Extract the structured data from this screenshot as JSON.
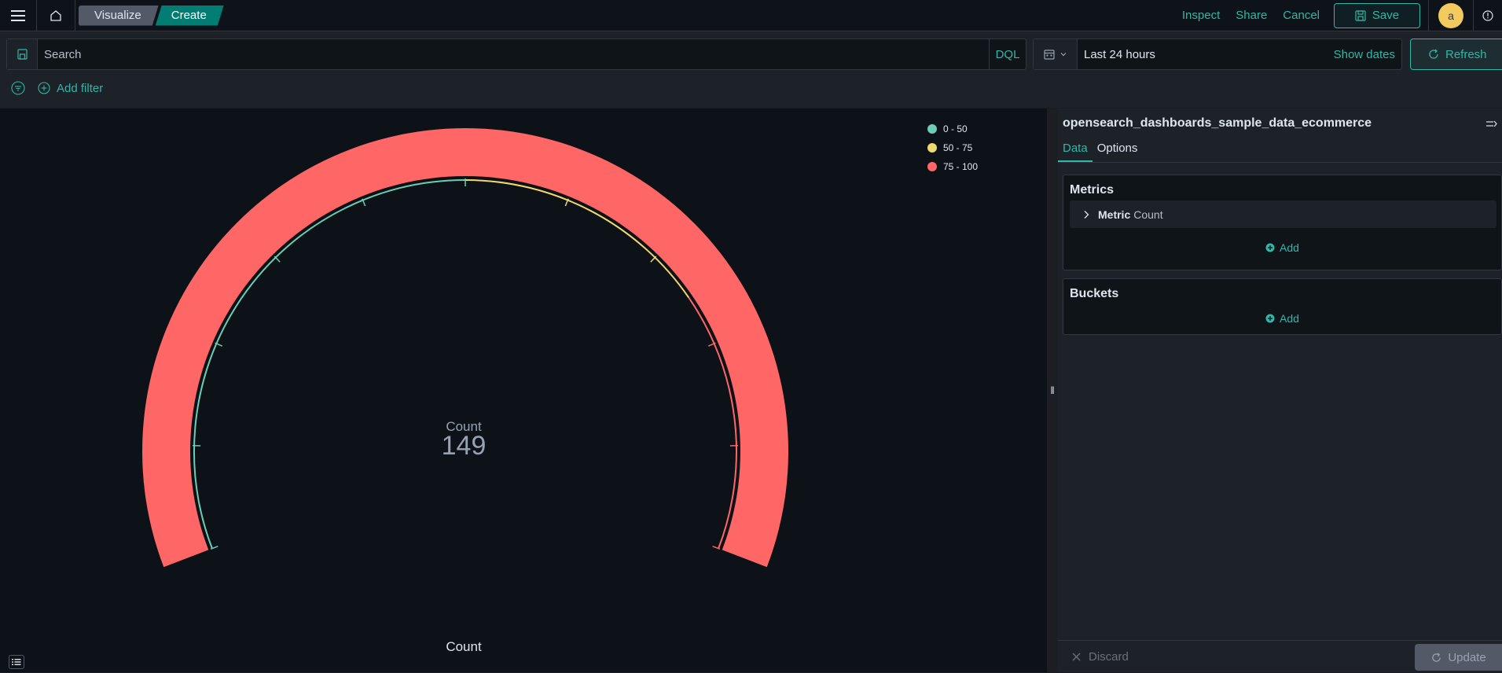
{
  "nav": {
    "breadcrumbs": [
      "Visualize",
      "Create"
    ],
    "links": [
      "Inspect",
      "Share",
      "Cancel"
    ],
    "save_label": "Save",
    "avatar_initial": "a"
  },
  "query": {
    "search_placeholder": "Search",
    "language": "DQL",
    "date_range": "Last 24 hours",
    "show_dates_label": "Show dates",
    "refresh_label": "Refresh",
    "add_filter_label": "Add filter"
  },
  "viz": {
    "legend": [
      {
        "label": "0 - 50",
        "color": "#6dccb1"
      },
      {
        "label": "50 - 75",
        "color": "#f1d86f"
      },
      {
        "label": "75 - 100",
        "color": "#ff6666"
      }
    ],
    "gauge_label": "Count",
    "gauge_value": "149",
    "title": "Count"
  },
  "chart_data": {
    "type": "gauge",
    "value": 149,
    "label": "Count",
    "range": [
      0,
      100
    ],
    "ranges": [
      {
        "from": 0,
        "to": 50,
        "label": "0 - 50",
        "color": "#6dccb1"
      },
      {
        "from": 50,
        "to": 75,
        "label": "50 - 75",
        "color": "#f1d86f"
      },
      {
        "from": 75,
        "to": 100,
        "label": "75 - 100",
        "color": "#ff6666"
      }
    ],
    "fill_color": "#ff6666",
    "title": "Count",
    "legend_position": "top-right"
  },
  "sidebar": {
    "index_pattern": "opensearch_dashboards_sample_data_ecommerce",
    "tabs": [
      "Data",
      "Options"
    ],
    "metrics_title": "Metrics",
    "metric": {
      "name": "Metric",
      "type": "Count"
    },
    "add_label": "Add",
    "buckets_title": "Buckets",
    "discard_label": "Discard",
    "update_label": "Update"
  }
}
